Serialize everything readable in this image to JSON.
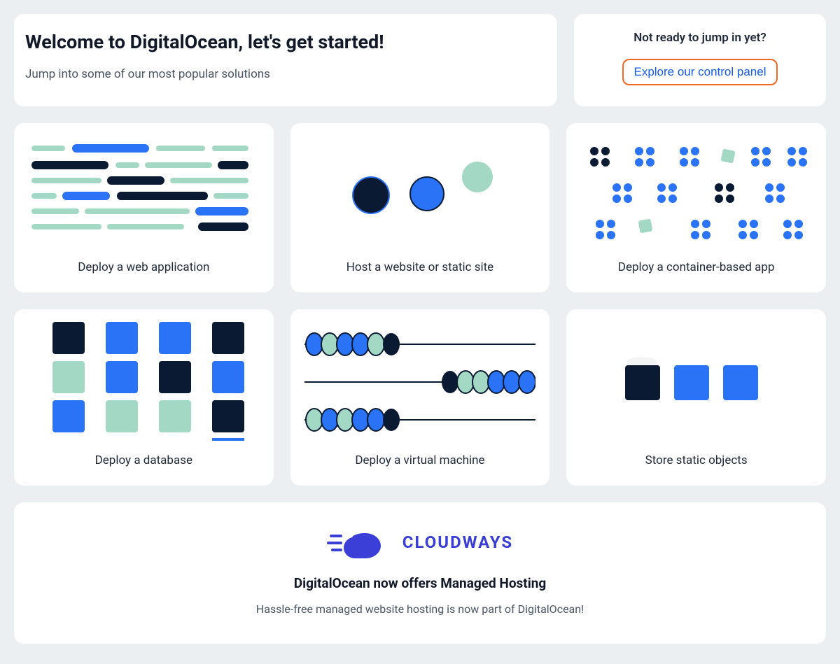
{
  "header": {
    "title": "Welcome to DigitalOcean, let's get started!",
    "subtitle": "Jump into some of our most popular solutions"
  },
  "side": {
    "prompt": "Not ready to jump in yet?",
    "cta": "Explore our control panel"
  },
  "tiles": [
    {
      "label": "Deploy a web application"
    },
    {
      "label": "Host a website or static site"
    },
    {
      "label": "Deploy a container-based app"
    },
    {
      "label": "Deploy a database"
    },
    {
      "label": "Deploy a virtual machine"
    },
    {
      "label": "Store static objects"
    }
  ],
  "banner": {
    "brand": "CLOUDWAYS",
    "headline": "DigitalOcean now offers Managed Hosting",
    "sub": "Hassle-free managed website hosting is now part of DigitalOcean!"
  },
  "colors": {
    "dark": "#0a1a33",
    "blue": "#2a72f6",
    "mint": "#a3d9c4",
    "indigo": "#3b3fd8"
  }
}
